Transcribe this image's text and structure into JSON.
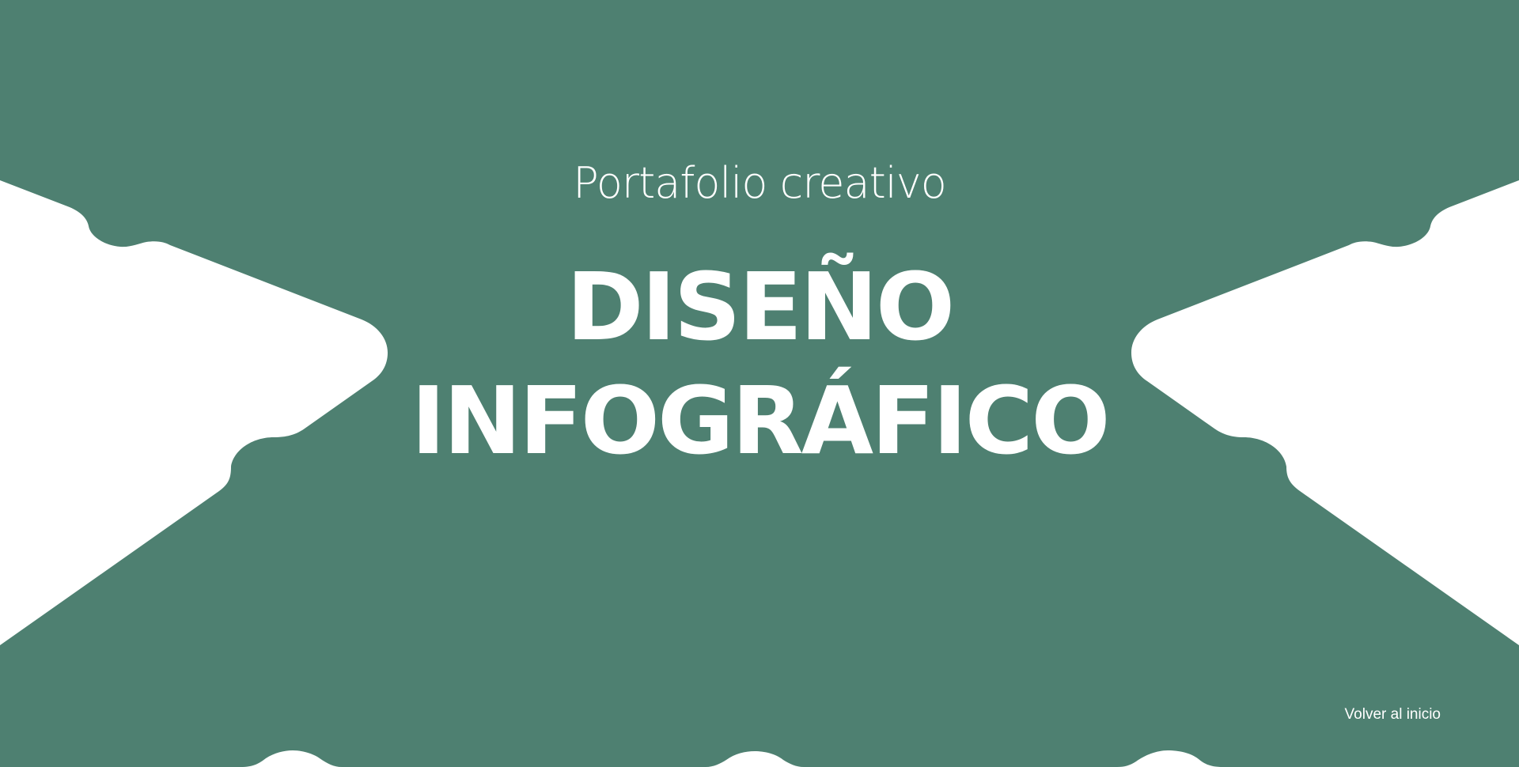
{
  "colors": {
    "background": "#4e8071",
    "page": "#ffffff",
    "text": "#ffffff"
  },
  "hero": {
    "eyebrow": "Portafolio creativo",
    "title_line_1": "DISEÑO",
    "title_line_2": "INFOGRÁFICO"
  },
  "footer": {
    "back_link": "Volver al inicio"
  }
}
